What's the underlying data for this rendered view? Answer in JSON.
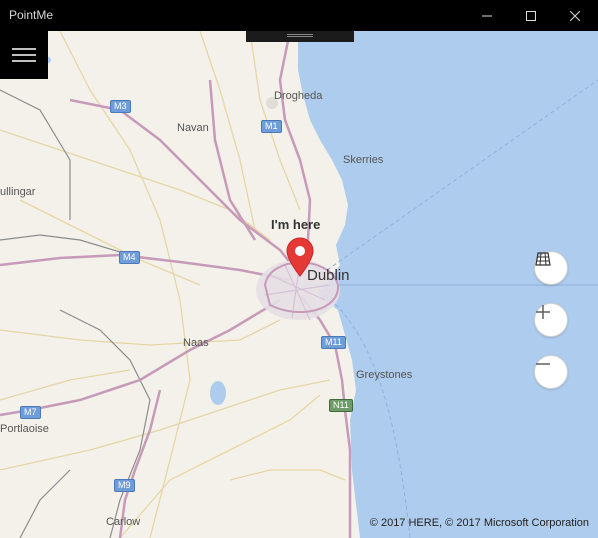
{
  "window": {
    "title": "PointMe",
    "controls": {
      "minimize": "minimize-icon",
      "maximize": "maximize-icon",
      "close": "close-icon"
    }
  },
  "nav": {
    "menu_icon": "hamburger-icon"
  },
  "map": {
    "pin": {
      "label": "I'm here",
      "icon": "map-pin-icon",
      "color": "#e53935"
    },
    "places": {
      "drogheda": "Drogheda",
      "navan": "Navan",
      "skerries": "Skerries",
      "mullingar": "ullingar",
      "dublin": "Dublin",
      "naas": "Naas",
      "greystones": "Greystones",
      "portlaoise": "Portlaoise",
      "carlow": "Carlow"
    },
    "road_shields": {
      "m3": "M3",
      "m1": "M1",
      "m4": "M4",
      "m11": "M11",
      "n11": "N11",
      "m7": "M7",
      "m9": "M9"
    },
    "controls": {
      "map_view": "map-view-icon",
      "zoom_in": "zoom-in-icon",
      "zoom_out": "zoom-out-icon"
    },
    "copyright": "© 2017 HERE, © 2017 Microsoft Corporation",
    "colors": {
      "sea": "#aecdee",
      "land": "#f3f1ea",
      "motorway": "#c69ab8",
      "road": "#e8d8a8"
    }
  }
}
